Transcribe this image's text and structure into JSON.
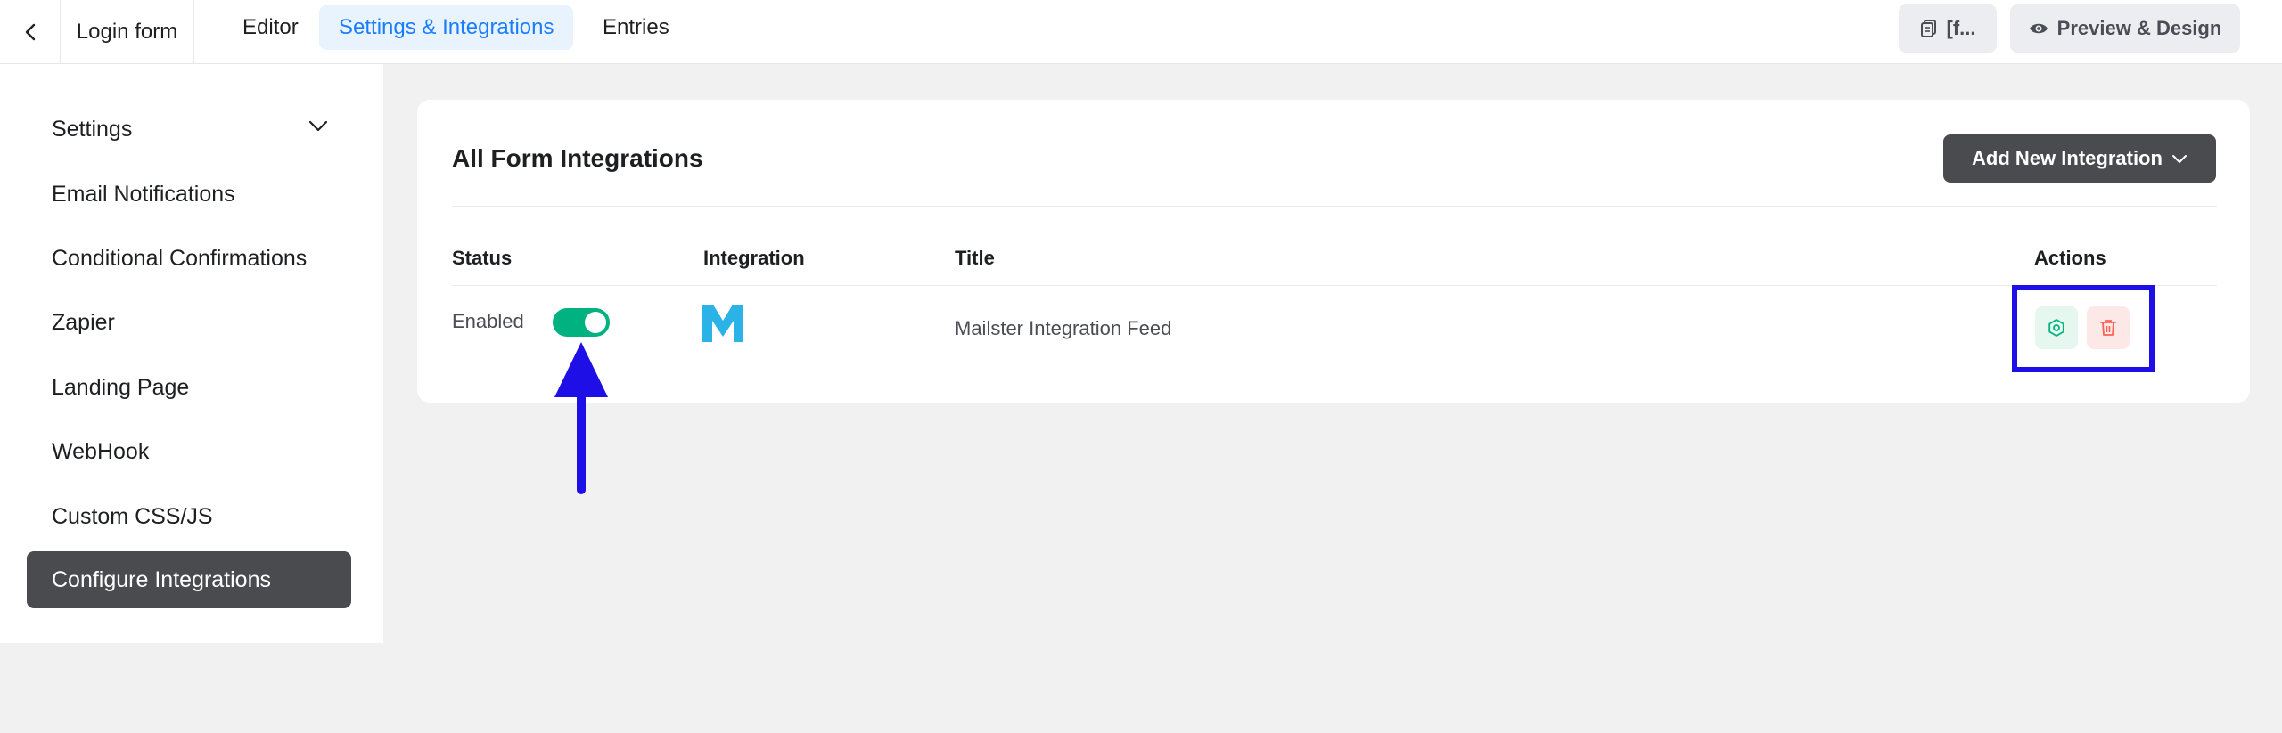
{
  "header": {
    "back_icon": "chevron-left-icon",
    "form_name": "Login form",
    "tabs": [
      {
        "label": "Editor",
        "active": false
      },
      {
        "label": "Settings & Integrations",
        "active": true
      },
      {
        "label": "Entries",
        "active": false
      }
    ],
    "shortcode_label": "[f...",
    "preview_label": "Preview & Design"
  },
  "sidebar": {
    "items": [
      {
        "label": "Settings",
        "has_chevron": true
      },
      {
        "label": "Email Notifications"
      },
      {
        "label": "Conditional Confirmations"
      },
      {
        "label": "Zapier"
      },
      {
        "label": "Landing Page"
      },
      {
        "label": "WebHook"
      },
      {
        "label": "Custom CSS/JS"
      },
      {
        "label": "Configure Integrations",
        "active": true
      }
    ]
  },
  "main": {
    "title": "All Form Integrations",
    "add_button_label": "Add New Integration",
    "columns": {
      "status": "Status",
      "integration": "Integration",
      "title": "Title",
      "actions": "Actions"
    },
    "rows": [
      {
        "status": "Enabled",
        "enabled": true,
        "integration_icon": "mailster-logo-icon",
        "title": "Mailster Integration Feed"
      }
    ]
  },
  "colors": {
    "accent": "#1a7efb",
    "toggle_on": "#00b27f",
    "dark_button": "#4a4b4f",
    "annotation": "#1e0fe6",
    "mailster_blue": "#2bb3e8"
  }
}
